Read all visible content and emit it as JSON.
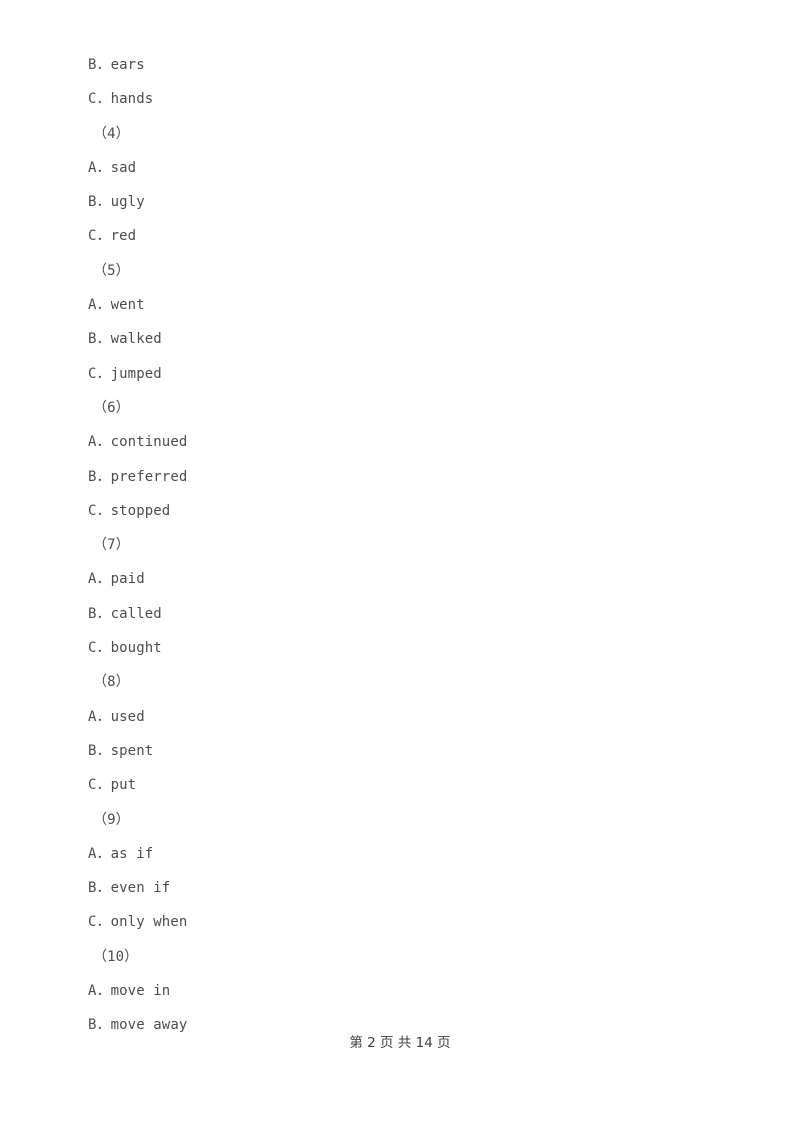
{
  "page": {
    "background_color": "#ffffff",
    "text_color": "#4d4d4d"
  },
  "document": {
    "lines": [
      {
        "kind": "option",
        "text": "B．ears"
      },
      {
        "kind": "option",
        "text": "C．hands"
      },
      {
        "kind": "qnum",
        "text": "（4）"
      },
      {
        "kind": "option",
        "text": "A．sad"
      },
      {
        "kind": "option",
        "text": "B．ugly"
      },
      {
        "kind": "option",
        "text": "C．red"
      },
      {
        "kind": "qnum",
        "text": "（5）"
      },
      {
        "kind": "option",
        "text": "A．went"
      },
      {
        "kind": "option",
        "text": "B．walked"
      },
      {
        "kind": "option",
        "text": "C．jumped"
      },
      {
        "kind": "qnum",
        "text": "（6）"
      },
      {
        "kind": "option",
        "text": "A．continued"
      },
      {
        "kind": "option",
        "text": "B．preferred"
      },
      {
        "kind": "option",
        "text": "C．stopped"
      },
      {
        "kind": "qnum",
        "text": "（7）"
      },
      {
        "kind": "option",
        "text": "A．paid"
      },
      {
        "kind": "option",
        "text": "B．called"
      },
      {
        "kind": "option",
        "text": "C．bought"
      },
      {
        "kind": "qnum",
        "text": "（8）"
      },
      {
        "kind": "option",
        "text": "A．used"
      },
      {
        "kind": "option",
        "text": "B．spent"
      },
      {
        "kind": "option",
        "text": "C．put"
      },
      {
        "kind": "qnum",
        "text": "（9）"
      },
      {
        "kind": "option",
        "text": "A．as if"
      },
      {
        "kind": "option",
        "text": "B．even if"
      },
      {
        "kind": "option",
        "text": "C．only when"
      },
      {
        "kind": "qnum",
        "text": "（10）"
      },
      {
        "kind": "option",
        "text": "A．move in"
      },
      {
        "kind": "option",
        "text": "B．move away"
      }
    ]
  },
  "footer": {
    "text": "第 2 页 共 14 页",
    "current_page": "2",
    "total_pages": "14"
  }
}
